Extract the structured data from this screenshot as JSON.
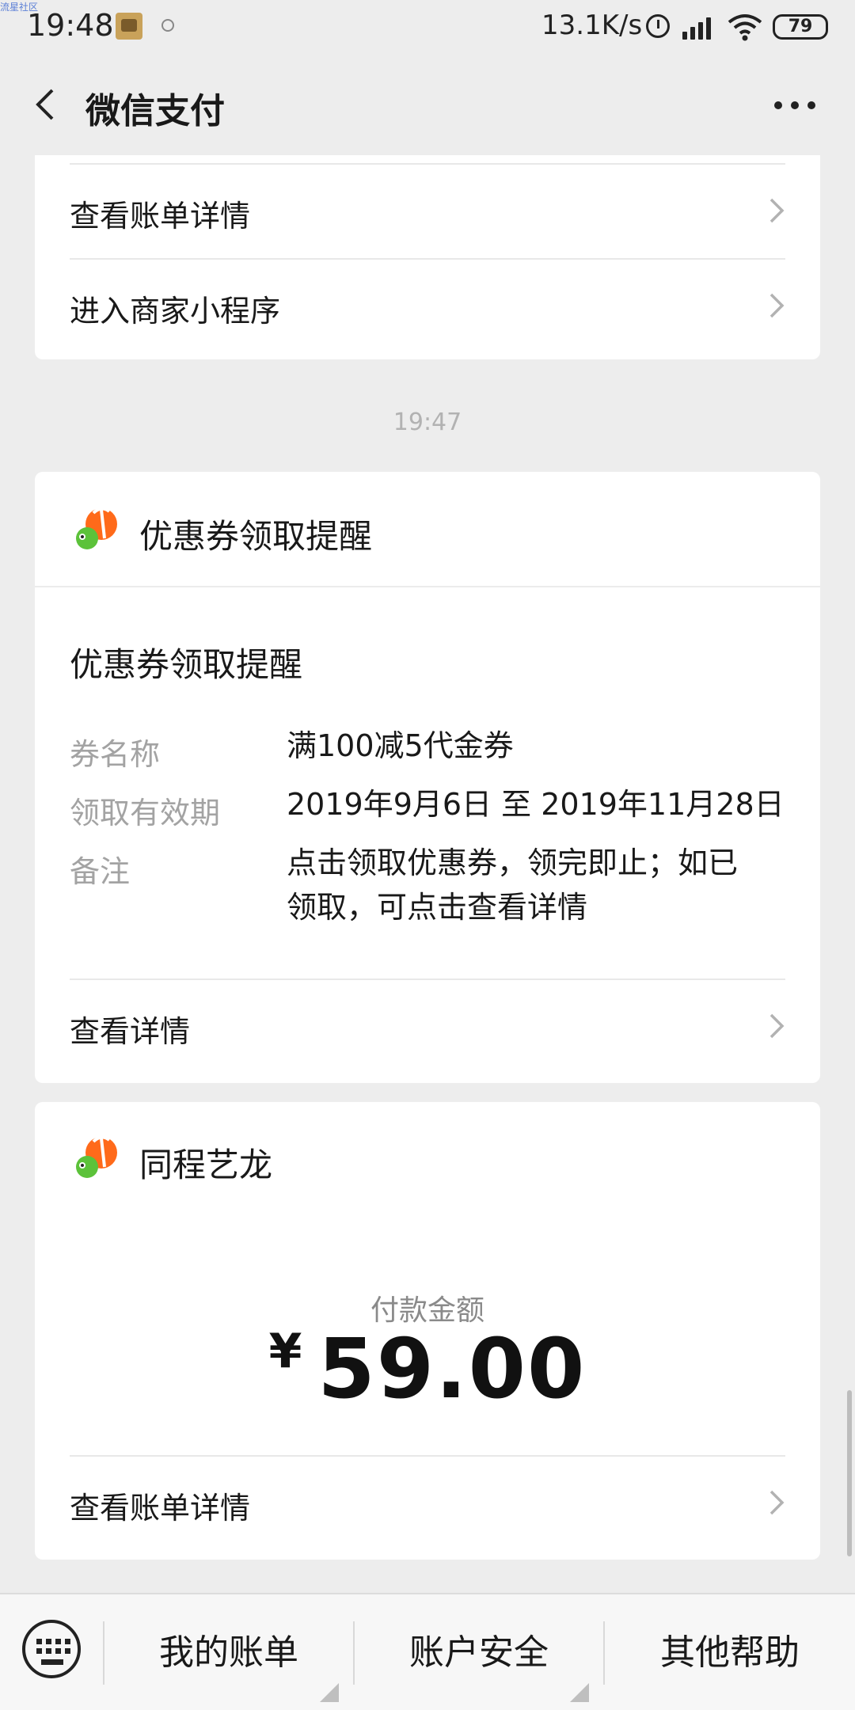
{
  "status_bar": {
    "tag": "流星社区",
    "time": "19:48",
    "speed": "13.1K/s",
    "battery": "79"
  },
  "nav": {
    "title": "微信支付"
  },
  "card_top": {
    "rows": [
      {
        "label": "查看账单详情"
      },
      {
        "label": "进入商家小程序"
      }
    ]
  },
  "timestamp": "19:47",
  "coupon_card": {
    "header_title": "优惠券领取提醒",
    "message_title": "优惠券领取提醒",
    "fields": [
      {
        "key": "券名称",
        "value": "满100减5代金券"
      },
      {
        "key": "领取有效期",
        "value": "2019年9月6日 至 2019年11月28日"
      },
      {
        "key": "备注",
        "value": "点击领取优惠券，领完即止；如已领取，可点击查看详情"
      }
    ],
    "action_label": "查看详情"
  },
  "payment_card": {
    "merchant": "同程艺龙",
    "amount_label": "付款金额",
    "currency": "¥",
    "amount": "59.00",
    "action_label": "查看账单详情"
  },
  "bottom_menu": {
    "items": [
      {
        "label": "我的账单"
      },
      {
        "label": "账户安全"
      },
      {
        "label": "其他帮助"
      }
    ]
  },
  "colors": {
    "background": "#ededed",
    "card": "#ffffff",
    "muted_text": "#a3a3a3",
    "fish_orange": "#ff6a1a",
    "fish_green": "#5cc23a"
  }
}
